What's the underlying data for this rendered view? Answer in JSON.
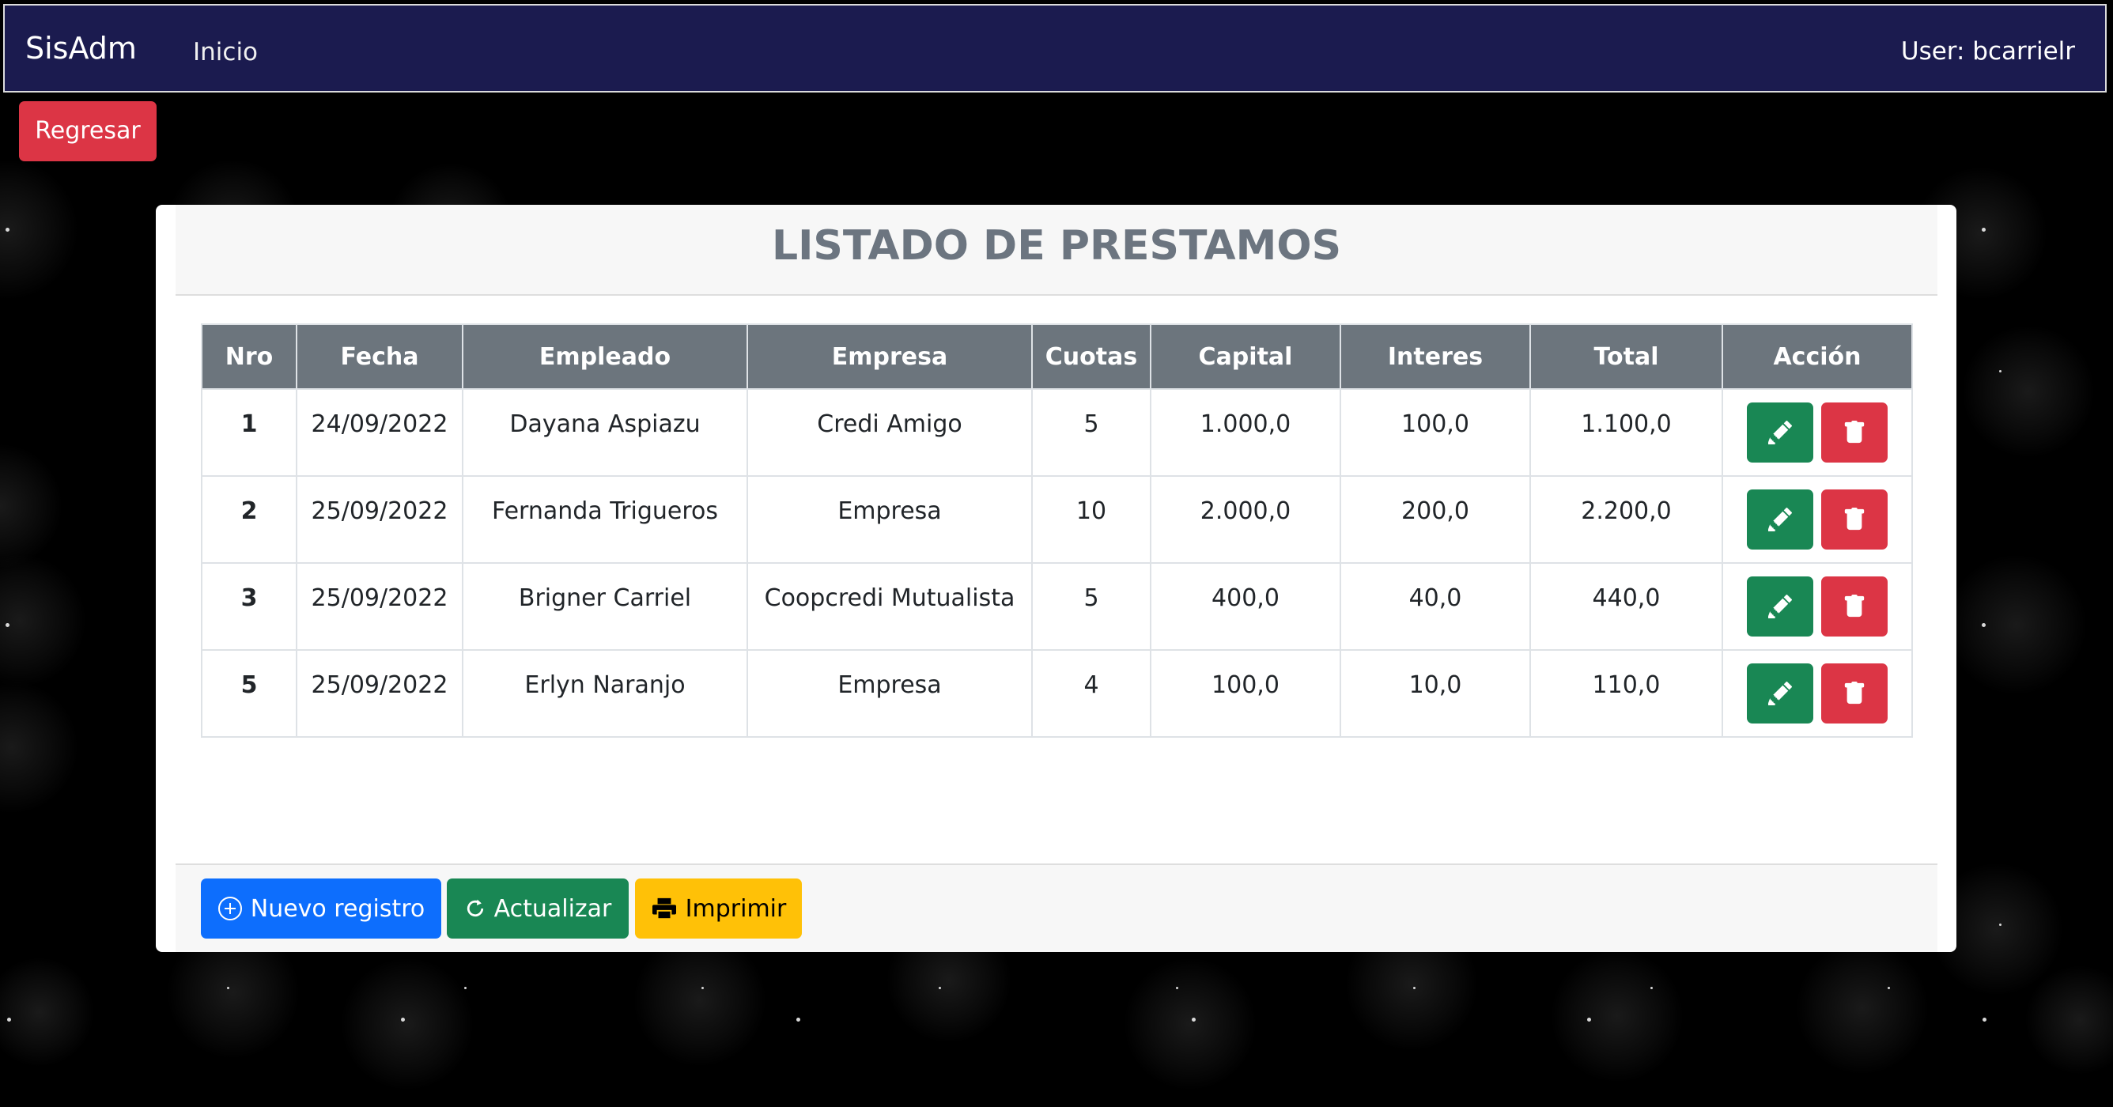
{
  "navbar": {
    "brand": "SisAdm",
    "home_link": "Inicio",
    "user_label": "User: bcarrielr"
  },
  "back_button": "Regresar",
  "card": {
    "title": "LISTADO DE PRESTAMOS",
    "table": {
      "headers": [
        "Nro",
        "Fecha",
        "Empleado",
        "Empresa",
        "Cuotas",
        "Capital",
        "Interes",
        "Total",
        "Acción"
      ],
      "rows": [
        [
          "1",
          "24/09/2022",
          "Dayana Aspiazu",
          "Credi Amigo",
          "5",
          "1.000,0",
          "100,0",
          "1.100,0"
        ],
        [
          "2",
          "25/09/2022",
          "Fernanda Trigueros",
          "Empresa",
          "10",
          "2.000,0",
          "200,0",
          "2.200,0"
        ],
        [
          "3",
          "25/09/2022",
          "Brigner Carriel",
          "Coopcredi Mutualista",
          "5",
          "400,0",
          "40,0",
          "440,0"
        ],
        [
          "5",
          "25/09/2022",
          "Erlyn Naranjo",
          "Empresa",
          "4",
          "100,0",
          "10,0",
          "110,0"
        ]
      ]
    },
    "footer": {
      "new_label": "Nuevo registro",
      "refresh_label": "Actualizar",
      "print_label": "Imprimir"
    }
  },
  "colors": {
    "navbar": "#1b1b4f",
    "danger": "#dc3545",
    "success": "#198754",
    "primary": "#0d6efd",
    "warning": "#ffc107",
    "table_header": "#6c757d",
    "title": "#6c7580"
  },
  "icons": {
    "edit": "pencil-icon",
    "delete": "trash-icon",
    "new": "plus-circle-icon",
    "refresh": "refresh-icon",
    "print": "printer-icon"
  }
}
